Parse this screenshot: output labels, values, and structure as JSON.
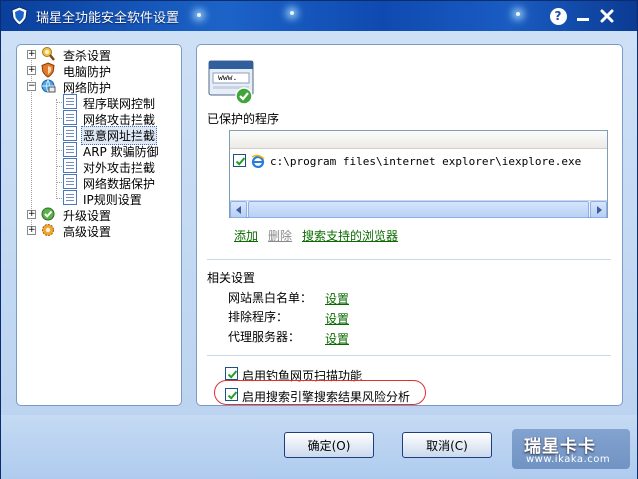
{
  "window": {
    "title": "瑞星全功能安全软件设置",
    "help_label": "?",
    "minimize_label": "—",
    "close_label": "✕"
  },
  "tree": {
    "items": [
      {
        "label": "查杀设置",
        "expander": "+",
        "icon": "magnifier-shield-icon"
      },
      {
        "label": "电脑防护",
        "expander": "+",
        "icon": "shield-icon"
      },
      {
        "label": "网络防护",
        "expander": "−",
        "icon": "network-globe-icon"
      },
      {
        "label": "程序联网控制",
        "icon": "document-icon"
      },
      {
        "label": "网络攻击拦截",
        "icon": "document-icon"
      },
      {
        "label": "恶意网址拦截",
        "icon": "document-icon",
        "selected": true
      },
      {
        "label": "ARP 欺骗防御",
        "icon": "document-icon"
      },
      {
        "label": "对外攻击拦截",
        "icon": "document-icon"
      },
      {
        "label": "网络数据保护",
        "icon": "document-icon"
      },
      {
        "label": "IP规则设置",
        "icon": "document-icon"
      },
      {
        "label": "升级设置",
        "expander": "+",
        "icon": "globe-check-icon"
      },
      {
        "label": "高级设置",
        "expander": "+",
        "icon": "gear-icon"
      }
    ]
  },
  "main": {
    "banner_text": "www.",
    "protected_heading": "已保护的程序",
    "program_list": {
      "rows": [
        {
          "checked": true,
          "path": "c:\\program files\\internet explorer\\iexplore.exe"
        }
      ]
    },
    "actions": {
      "add": "添加",
      "delete": "删除",
      "search_browsers": "搜索支持的浏览器"
    },
    "related_heading": "相关设置",
    "related": [
      {
        "label": "网站黑白名单：",
        "link": "设置"
      },
      {
        "label": "排除程序：",
        "link": "设置"
      },
      {
        "label": "代理服务器：",
        "link": "设置"
      }
    ],
    "options": [
      {
        "label": "启用钓鱼网页扫描功能",
        "checked": true
      },
      {
        "label": "启用搜索引擎搜索结果风险分析",
        "checked": true
      }
    ]
  },
  "buttons": {
    "ok": "确定(O)",
    "cancel": "取消(C)"
  },
  "watermark": {
    "logo": "瑞星卡卡",
    "url": "www.ikaka.com"
  },
  "colors": {
    "title_bar": "#1c63c8",
    "link_green": "#0b6b00",
    "highlight_red": "#e03030"
  }
}
